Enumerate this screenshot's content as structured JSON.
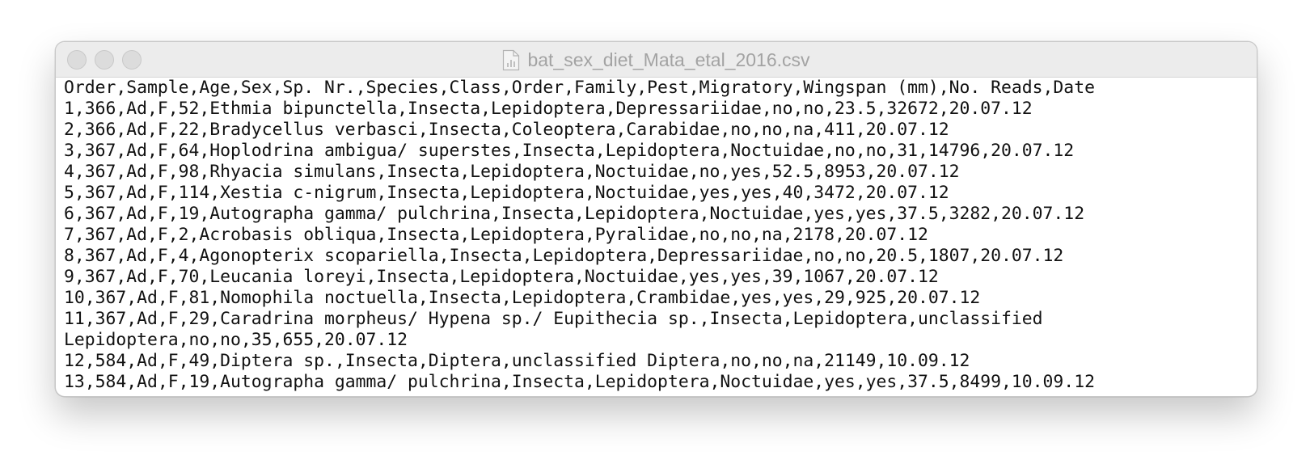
{
  "window": {
    "title": "bat_sex_diet_Mata_etal_2016.csv",
    "file_icon": "document-icon"
  },
  "content": {
    "lines": [
      "Order,Sample,Age,Sex,Sp. Nr.,Species,Class,Order,Family,Pest,Migratory,Wingspan (mm),No. Reads,Date",
      "1,366,Ad,F,52,Ethmia bipunctella,Insecta,Lepidoptera,Depressariidae,no,no,23.5,32672,20.07.12",
      "2,366,Ad,F,22,Bradycellus verbasci,Insecta,Coleoptera,Carabidae,no,no,na,411,20.07.12",
      "3,367,Ad,F,64,Hoplodrina ambigua/ superstes,Insecta,Lepidoptera,Noctuidae,no,no,31,14796,20.07.12",
      "4,367,Ad,F,98,Rhyacia simulans,Insecta,Lepidoptera,Noctuidae,no,yes,52.5,8953,20.07.12",
      "5,367,Ad,F,114,Xestia c-nigrum,Insecta,Lepidoptera,Noctuidae,yes,yes,40,3472,20.07.12",
      "6,367,Ad,F,19,Autographa gamma/ pulchrina,Insecta,Lepidoptera,Noctuidae,yes,yes,37.5,3282,20.07.12",
      "7,367,Ad,F,2,Acrobasis obliqua,Insecta,Lepidoptera,Pyralidae,no,no,na,2178,20.07.12",
      "8,367,Ad,F,4,Agonopterix scopariella,Insecta,Lepidoptera,Depressariidae,no,no,20.5,1807,20.07.12",
      "9,367,Ad,F,70,Leucania loreyi,Insecta,Lepidoptera,Noctuidae,yes,yes,39,1067,20.07.12",
      "10,367,Ad,F,81,Nomophila noctuella,Insecta,Lepidoptera,Crambidae,yes,yes,29,925,20.07.12",
      "11,367,Ad,F,29,Caradrina morpheus/ Hypena sp./ Eupithecia sp.,Insecta,Lepidoptera,unclassified",
      "Lepidoptera,no,no,35,655,20.07.12",
      "12,584,Ad,F,49,Diptera sp.,Insecta,Diptera,unclassified Diptera,no,no,na,21149,10.09.12",
      "13,584,Ad,F,19,Autographa gamma/ pulchrina,Insecta,Lepidoptera,Noctuidae,yes,yes,37.5,8499,10.09.12"
    ]
  }
}
